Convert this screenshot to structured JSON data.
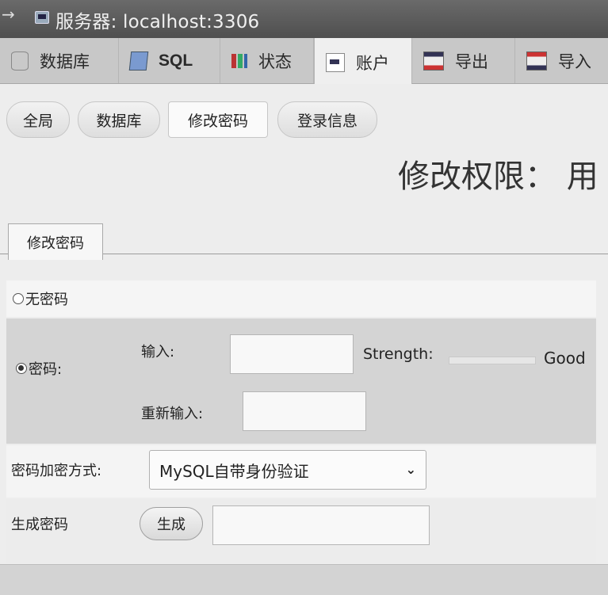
{
  "server_bar": {
    "arrow": "→",
    "title": "服务器: localhost:3306"
  },
  "main_tabs": [
    {
      "label": "数据库",
      "icon": "database-icon"
    },
    {
      "label": "SQL",
      "icon": "sql-icon"
    },
    {
      "label": "状态",
      "icon": "status-icon"
    },
    {
      "label": "账户",
      "icon": "account-icon",
      "active": true
    },
    {
      "label": "导出",
      "icon": "export-icon"
    },
    {
      "label": "导入",
      "icon": "import-icon"
    }
  ],
  "sub_tabs": [
    {
      "label": "全局"
    },
    {
      "label": "数据库"
    },
    {
      "label": "修改密码",
      "active": true
    },
    {
      "label": "登录信息"
    }
  ],
  "page_heading": "修改权限： 用",
  "fieldset": {
    "legend": "修改密码",
    "no_password_label": "无密码",
    "password_label": "密码:",
    "enter_label": "输入:",
    "reenter_label": "重新输入:",
    "strength_label": "Strength:",
    "strength_value": "Good",
    "strength_level": 0.0,
    "method_label": "密码加密方式:",
    "method_value": "MySQL自带身份验证",
    "generate_label": "生成密码",
    "generate_button": "生成"
  },
  "colors": {
    "server_bar": "#5a5a5a",
    "tab_bar": "#c8c8c8",
    "content_bg": "#ededed"
  }
}
